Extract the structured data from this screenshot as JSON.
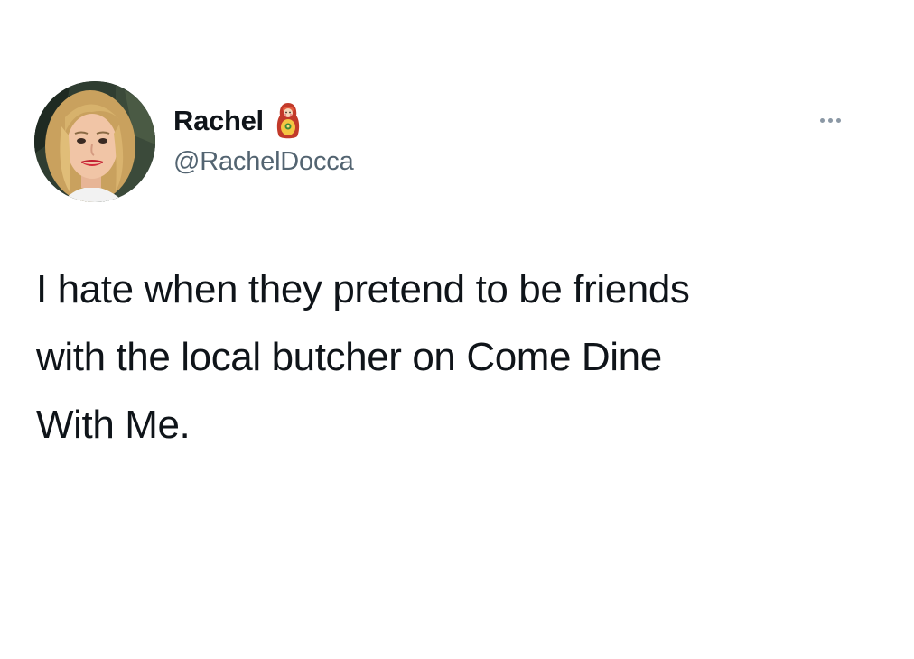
{
  "tweet": {
    "author": {
      "display_name": "Rachel",
      "name_emoji": "matryoshka-doll-icon",
      "handle": "@RachelDocca",
      "avatar": "avatar"
    },
    "more_icon": "ellipsis-icon",
    "text": "I hate when they pretend to be friends\nwith the local butcher on Come Dine\nWith Me."
  },
  "colors": {
    "background": "#ffffff",
    "text_primary": "#0f1419",
    "text_secondary": "#536471",
    "icon_muted": "#8b98a5"
  }
}
